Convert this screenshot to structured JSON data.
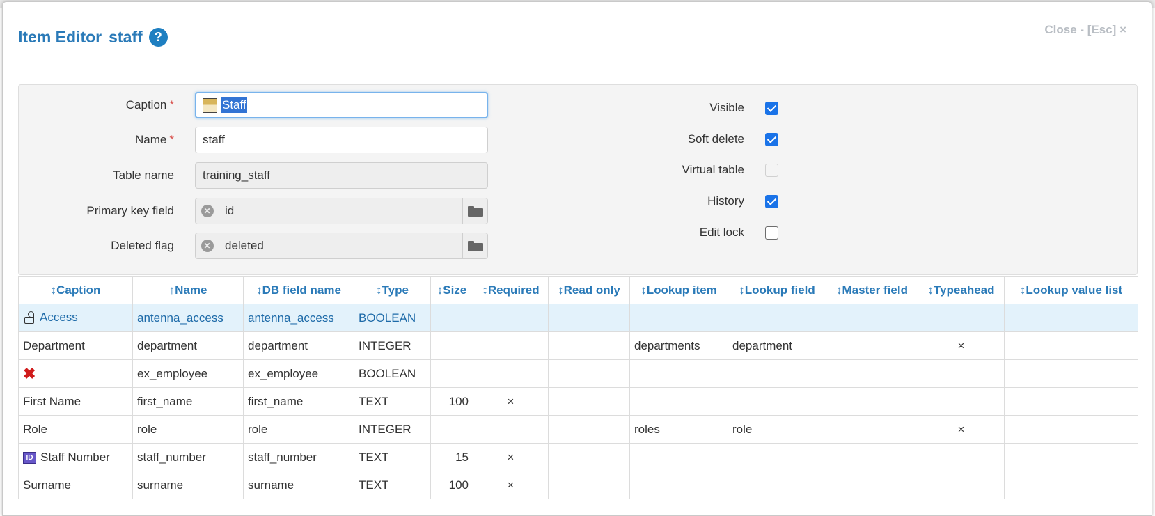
{
  "header": {
    "title": "Item Editor",
    "item_name": "staff",
    "help_icon": "?",
    "close_label": "Close - [Esc] ×"
  },
  "form": {
    "caption": {
      "label": "Caption",
      "required_mark": "*",
      "value": "Staff"
    },
    "name": {
      "label": "Name",
      "required_mark": "*",
      "value": "staff"
    },
    "table_name": {
      "label": "Table name",
      "value": "training_staff"
    },
    "primary_key_field": {
      "label": "Primary key field",
      "value": "id"
    },
    "deleted_flag": {
      "label": "Deleted flag",
      "value": "deleted"
    },
    "checkboxes": [
      {
        "label": "Visible",
        "checked": true,
        "disabled": false
      },
      {
        "label": "Soft delete",
        "checked": true,
        "disabled": false
      },
      {
        "label": "Virtual table",
        "checked": false,
        "disabled": true
      },
      {
        "label": "History",
        "checked": true,
        "disabled": false
      },
      {
        "label": "Edit lock",
        "checked": false,
        "disabled": false
      }
    ]
  },
  "grid": {
    "columns": [
      {
        "label": "↕Caption"
      },
      {
        "label": "↑Name"
      },
      {
        "label": "↕DB field name"
      },
      {
        "label": "↕Type"
      },
      {
        "label": "↕Size"
      },
      {
        "label": "↕Required"
      },
      {
        "label": "↕Read only"
      },
      {
        "label": "↕Lookup item"
      },
      {
        "label": "↕Lookup field"
      },
      {
        "label": "↕Master field"
      },
      {
        "label": "↕Typeahead"
      },
      {
        "label": "↕Lookup value list"
      }
    ],
    "rows": [
      {
        "icon": "access-icon",
        "caption": "Access",
        "name": "antenna_access",
        "db_field": "antenna_access",
        "type": "BOOLEAN",
        "size": "",
        "required": "",
        "read_only": "",
        "lookup_item": "",
        "lookup_field": "",
        "master_field": "",
        "typeahead": "",
        "lookup_value_list": "",
        "selected": true
      },
      {
        "icon": "",
        "caption": "Department",
        "name": "department",
        "db_field": "department",
        "type": "INTEGER",
        "size": "",
        "required": "",
        "read_only": "",
        "lookup_item": "departments",
        "lookup_field": "department",
        "master_field": "",
        "typeahead": "×",
        "lookup_value_list": "",
        "selected": false
      },
      {
        "icon": "red-x-icon",
        "caption": "",
        "name": "ex_employee",
        "db_field": "ex_employee",
        "type": "BOOLEAN",
        "size": "",
        "required": "",
        "read_only": "",
        "lookup_item": "",
        "lookup_field": "",
        "master_field": "",
        "typeahead": "",
        "lookup_value_list": "",
        "selected": false
      },
      {
        "icon": "",
        "caption": "First Name",
        "name": "first_name",
        "db_field": "first_name",
        "type": "TEXT",
        "size": "100",
        "required": "×",
        "read_only": "",
        "lookup_item": "",
        "lookup_field": "",
        "master_field": "",
        "typeahead": "",
        "lookup_value_list": "",
        "selected": false
      },
      {
        "icon": "",
        "caption": "Role",
        "name": "role",
        "db_field": "role",
        "type": "INTEGER",
        "size": "",
        "required": "",
        "read_only": "",
        "lookup_item": "roles",
        "lookup_field": "role",
        "master_field": "",
        "typeahead": "×",
        "lookup_value_list": "",
        "selected": false
      },
      {
        "icon": "id-badge-icon",
        "caption": "Staff Number",
        "name": "staff_number",
        "db_field": "staff_number",
        "type": "TEXT",
        "size": "15",
        "required": "×",
        "read_only": "",
        "lookup_item": "",
        "lookup_field": "",
        "master_field": "",
        "typeahead": "",
        "lookup_value_list": "",
        "selected": false
      },
      {
        "icon": "",
        "caption": "Surname",
        "name": "surname",
        "db_field": "surname",
        "type": "TEXT",
        "size": "100",
        "required": "×",
        "read_only": "",
        "lookup_item": "",
        "lookup_field": "",
        "master_field": "",
        "typeahead": "",
        "lookup_value_list": "",
        "selected": false
      }
    ]
  }
}
